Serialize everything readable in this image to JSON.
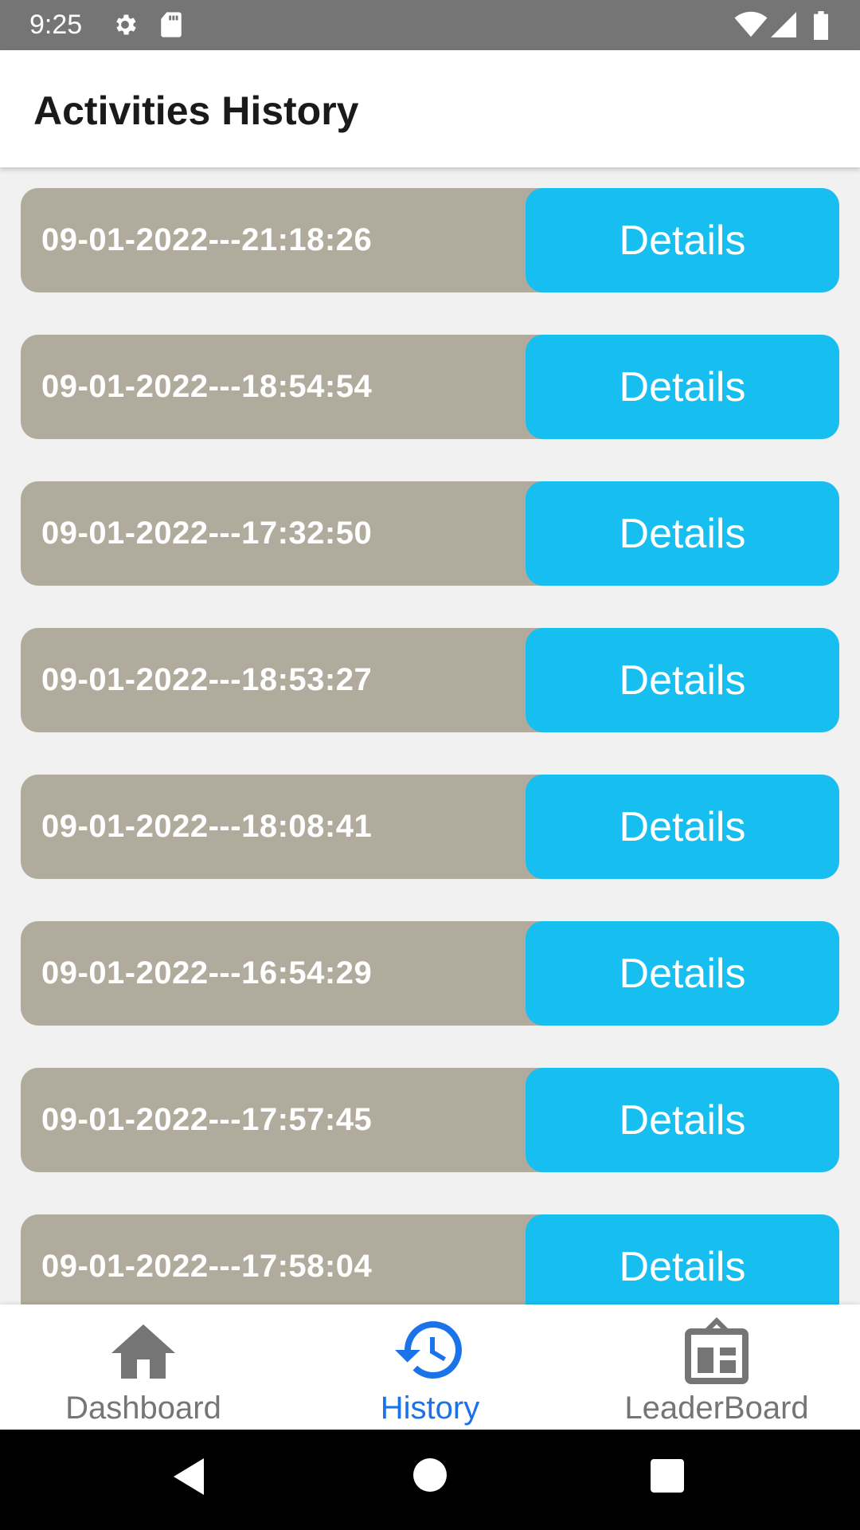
{
  "status_bar": {
    "time": "9:25",
    "left_icons": [
      "gear-icon",
      "sd-card-icon"
    ],
    "right_icons": [
      "wifi-icon",
      "signal-icon",
      "battery-icon"
    ]
  },
  "app_bar": {
    "title": "Activities History"
  },
  "history": {
    "items": [
      {
        "date": "09-01-2022---21:18:26",
        "button": "Details"
      },
      {
        "date": "09-01-2022---18:54:54",
        "button": "Details"
      },
      {
        "date": "09-01-2022---17:32:50",
        "button": "Details"
      },
      {
        "date": "09-01-2022---18:53:27",
        "button": "Details"
      },
      {
        "date": "09-01-2022---18:08:41",
        "button": "Details"
      },
      {
        "date": "09-01-2022---16:54:29",
        "button": "Details"
      },
      {
        "date": "09-01-2022---17:57:45",
        "button": "Details"
      },
      {
        "date": "09-01-2022---17:58:04",
        "button": "Details"
      }
    ]
  },
  "bottom_nav": {
    "items": [
      {
        "label": "Dashboard",
        "icon": "home-icon",
        "active": false
      },
      {
        "label": "History",
        "icon": "history-icon",
        "active": true
      },
      {
        "label": "LeaderBoard",
        "icon": "leaderboard-icon",
        "active": false
      }
    ]
  },
  "colors": {
    "row_background": "#b1ab9d",
    "details_button": "#17bff0",
    "active_nav": "#1a73e8",
    "inactive_nav": "#757575"
  }
}
